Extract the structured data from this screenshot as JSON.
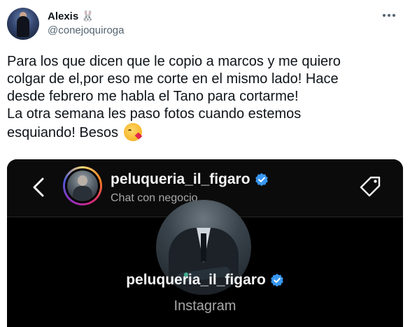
{
  "tweet": {
    "author_name": "Alexis",
    "author_emoji": "🐰",
    "author_handle": "@conejoquiroga",
    "text_lines": [
      "Para los que dicen que le copio a marcos y me quiero",
      "colgar de el,por eso me corte en el mismo lado! Hace",
      "desde febrero me habla el Tano para cortarme!",
      "La otra semana les paso fotos cuando estemos",
      "esquiando! Besos"
    ],
    "end_emoji": "kissing-face-with-heart-emoji"
  },
  "media": {
    "header": {
      "username": "peluqueria_il_figaro",
      "subtitle": "Chat con negocio"
    },
    "profile": {
      "username": "peluqueria_il_figaro",
      "platform": "Instagram"
    }
  },
  "colors": {
    "verified_blue": "#3897f0",
    "text_primary": "#0f1419",
    "text_secondary": "#536471",
    "ig_background": "#000000"
  }
}
